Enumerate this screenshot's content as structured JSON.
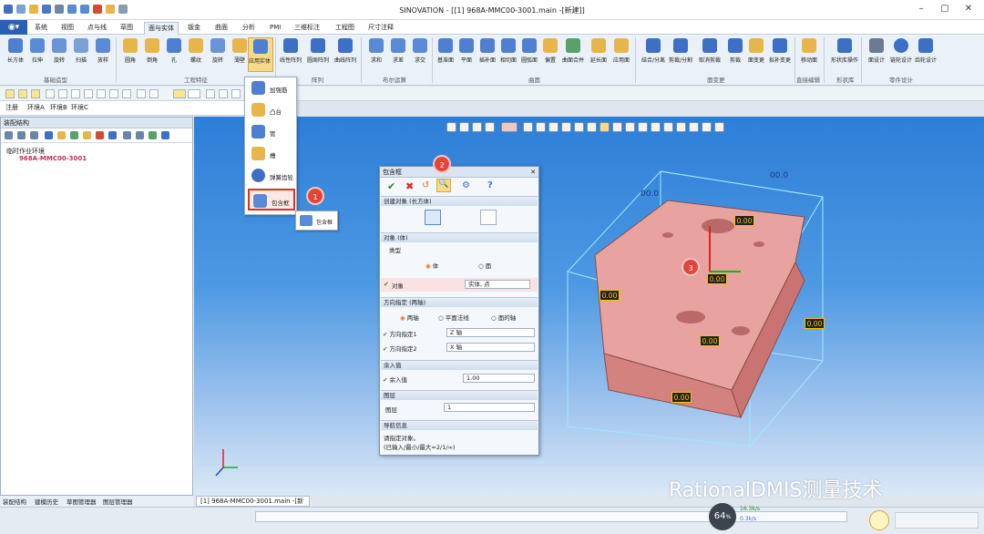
{
  "window": {
    "title": "SINOVATION - [[1] 968A-MMC00-3001.main -[新建]]",
    "minimize": "–",
    "maximize": "▢",
    "close": "✕"
  },
  "menu": {
    "file_label": "◉▾",
    "tabs": [
      "系统",
      "视图",
      "点与线",
      "草图",
      "面与实体",
      "钣金",
      "曲面",
      "分析",
      "PMI",
      "三维标注",
      "工程图",
      "尺寸注释"
    ],
    "active_tab": "面与实体"
  },
  "ribbon": {
    "buttons": [
      "长方体",
      "拉伸",
      "旋转",
      "扫描",
      "放样",
      "圆角",
      "倒角",
      "孔",
      "螺纹",
      "旋转",
      "薄壁",
      "应用实体",
      "线性阵列",
      "圆周阵列",
      "曲线阵列",
      "求和",
      "求差",
      "求交",
      "基准面",
      "平面",
      "插补面",
      "相切面",
      "圆弧面",
      "偏置",
      "曲面合并",
      "延长面",
      "应用面",
      "结合/分离",
      "剪裁/分割",
      "取消剪裁",
      "剪裁",
      "面变更",
      "拟补变更",
      "移动面",
      "形状库操作",
      "面设计",
      "链轮设计",
      "齿轮设计"
    ],
    "groups": [
      "基础造型",
      "工程特征",
      "阵列",
      "布尔运算",
      "曲面",
      "面变更",
      "直接编辑",
      "形状库",
      "零件设计"
    ]
  },
  "dropdown": {
    "items": [
      "加强筋",
      "凸台",
      "管",
      "槽",
      "弹簧齿轮",
      "包含框"
    ],
    "tooltip": "包含框"
  },
  "env_tabs": [
    "注册",
    "环境A",
    "环境B",
    "环境C"
  ],
  "left_panel": {
    "title": "装配结构",
    "tree": {
      "root": "临时作业环境",
      "child": "968A-MMC00-3001"
    },
    "bottom_tabs": [
      "装配结构",
      "建模历史",
      "草图管理器",
      "图层管理器"
    ]
  },
  "doc_tab": "[1] 968A-MMC00-3001.main -[新建]",
  "dialog": {
    "title": "包含框",
    "sections": {
      "create_obj": "创建对象 (长方体)",
      "object": "对象 (体)",
      "direction": "方向指定 (两轴)",
      "margin": "余入值",
      "layer": "图层",
      "nav": "导航信息"
    },
    "type_label": "类型",
    "type_options": [
      "体",
      "面"
    ],
    "object_label": "对象",
    "object_value": "实体, 点",
    "dir_options": [
      "两轴",
      "平面法线",
      "面的轴"
    ],
    "dir1_label": "方向指定1",
    "dir1_value": "Z 轴",
    "dir2_label": "方向指定2",
    "dir2_value": "X 轴",
    "margin_label": "余入值",
    "margin_value": "1.00",
    "layer_label": "图层",
    "layer_value": "1",
    "nav_text1": "请指定对象。",
    "nav_text2": "(已输入/最小/最大=2/1/∞)"
  },
  "viewport": {
    "dim_top": "00.0",
    "dim_left": "00.0",
    "labels": [
      "0.00",
      "0.00",
      "0.00",
      "0.00",
      "0.00",
      "0.00"
    ]
  },
  "badges": [
    "1",
    "2",
    "3"
  ],
  "watermark": "RationalDMIS测量技术",
  "gauge": {
    "value": "64",
    "unit": "%",
    "up": "16.3k/s",
    "down": "0.3k/s"
  },
  "colors": {
    "accent": "#2b5fb4",
    "model": "#e8a3a1",
    "badge": "#e2463a"
  }
}
